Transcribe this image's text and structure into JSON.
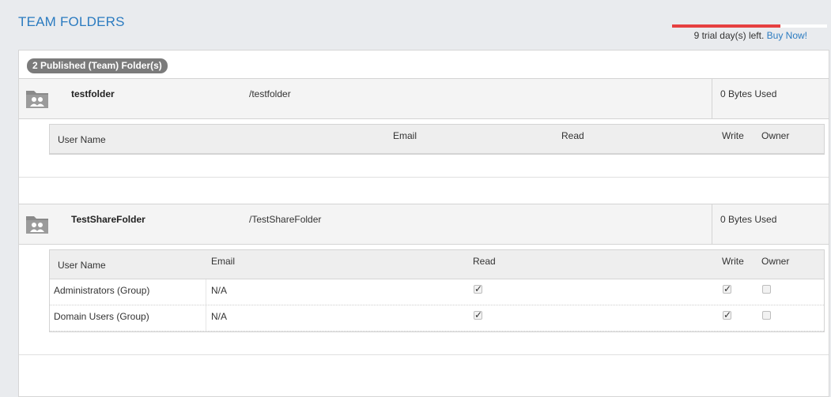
{
  "page": {
    "title": "TEAM FOLDERS"
  },
  "trial": {
    "progress": 0.7,
    "text": "9 trial day(s) left.",
    "link": "Buy Now!"
  },
  "summary": {
    "badge": "2 Published (Team) Folder(s)"
  },
  "columns": {
    "user_name": "User Name",
    "email": "Email",
    "read": "Read",
    "write": "Write",
    "owner": "Owner"
  },
  "folders": [
    {
      "name": "testfolder",
      "path": "/testfolder",
      "usage": "0 Bytes Used",
      "users": []
    },
    {
      "name": "TestShareFolder",
      "path": "/TestShareFolder",
      "usage": "0 Bytes Used",
      "users": [
        {
          "name": "Administrators (Group)",
          "email": "N/A",
          "read": true,
          "write": true,
          "owner": false
        },
        {
          "name": "Domain Users (Group)",
          "email": "N/A",
          "read": true,
          "write": true,
          "owner": false
        }
      ]
    }
  ],
  "icons": {
    "folder": "team-folder-icon",
    "checkbox": "checkbox-icon"
  },
  "colors": {
    "accent": "#2b7bc0",
    "trial_bar": "#e64040",
    "badge": "#7b7b7b"
  }
}
